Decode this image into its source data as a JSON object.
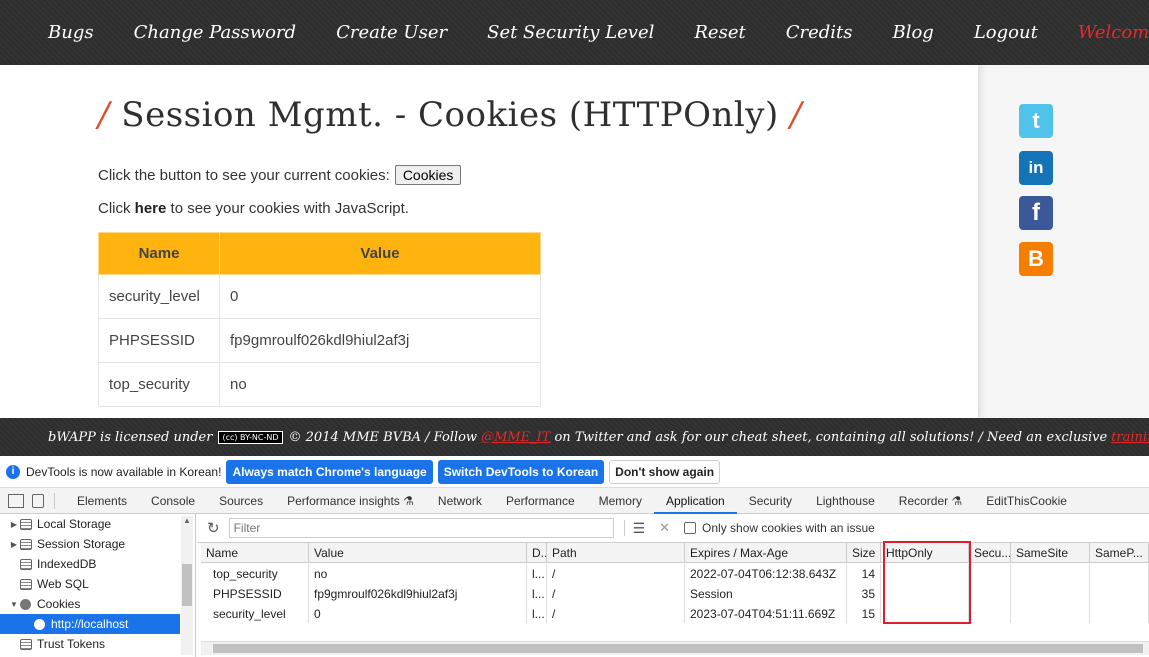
{
  "nav": {
    "items": [
      "Bugs",
      "Change Password",
      "Create User",
      "Set Security Level",
      "Reset",
      "Credits",
      "Blog",
      "Logout"
    ],
    "welcome": "Welcome Bee"
  },
  "page": {
    "title_slash": "/",
    "title": "Session Mgmt. - Cookies (HTTPOnly)",
    "line1_text": "Click the button to see your current cookies:",
    "cookies_button": "Cookies",
    "line2_prefix": "Click",
    "line2_link": "here",
    "line2_suffix": "to see your cookies with JavaScript.",
    "table": {
      "headers": [
        "Name",
        "Value"
      ],
      "rows": [
        [
          "security_level",
          "0"
        ],
        [
          "PHPSESSID",
          "fp9gmroulf026kdl9hiul2af3j"
        ],
        [
          "top_security",
          "no"
        ]
      ]
    },
    "social": [
      "t",
      "in",
      "f",
      "B"
    ]
  },
  "footer": {
    "prefix": "bWAPP is licensed under",
    "cc_badge": "(cc) BY-NC-ND",
    "middle": "© 2014 MME BVBA / Follow",
    "twitter_link": "@MME_IT",
    "after_link": "on Twitter and ask for our cheat sheet, containing all solutions! / Need an exclusive",
    "last_link": "training"
  },
  "infobar": {
    "message": "DevTools is now available in Korean!",
    "btn_match": "Always match Chrome's language",
    "btn_switch": "Switch DevTools to Korean",
    "btn_dismiss": "Don't show again"
  },
  "devtools": {
    "tabs": [
      "Elements",
      "Console",
      "Sources",
      "Performance insights",
      "Network",
      "Performance",
      "Memory",
      "Application",
      "Security",
      "Lighthouse",
      "Recorder",
      "EditThisCookie"
    ],
    "active_tab": "Application",
    "sidebar": [
      "Local Storage",
      "Session Storage",
      "IndexedDB",
      "Web SQL",
      "Cookies",
      "http://localhost",
      "Trust Tokens"
    ],
    "filter_placeholder": "Filter",
    "only_issue_label": "Only show cookies with an issue",
    "grid": {
      "headers": [
        "Name",
        "Value",
        "D..",
        "Path",
        "Expires / Max-Age",
        "Size",
        "HttpOnly",
        "Secu...",
        "SameSite",
        "SameP..."
      ],
      "rows": [
        [
          "top_security",
          "no",
          "l...",
          "/",
          "2022-07-04T06:12:38.643Z",
          "14",
          "",
          "",
          "",
          ""
        ],
        [
          "PHPSESSID",
          "fp9gmroulf026kdl9hiul2af3j",
          "l...",
          "/",
          "Session",
          "35",
          "",
          "",
          "",
          ""
        ],
        [
          "security_level",
          "0",
          "l...",
          "/",
          "2023-07-04T04:51:11.669Z",
          "15",
          "",
          "",
          "",
          ""
        ]
      ]
    }
  },
  "colors": {
    "accent_orange": "#ffb30f",
    "title_slash": "#e24a28",
    "welcome_red": "#e32b2b",
    "devtools_blue": "#1a73e8",
    "highlight_red": "#d9202c"
  }
}
